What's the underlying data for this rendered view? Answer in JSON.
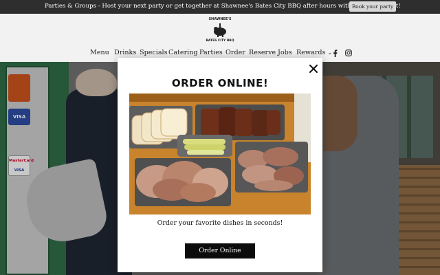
{
  "announcement": {
    "text": "Parties & Groups - Host your next party or get together at Shawnee's Bates City BBQ after hours with a private event!",
    "button_label": "Book your party"
  },
  "logo": {
    "top_text": "SHAWNEE'S",
    "bottom_text": "BATES CITY BBQ"
  },
  "nav": {
    "items": [
      "Menu",
      "Drinks",
      "Specials",
      "Catering",
      "Parties",
      "Order",
      "Reserve",
      "Jobs",
      "Rewards"
    ],
    "rewards_caret": "⌄",
    "social": [
      "facebook-icon",
      "instagram-icon"
    ]
  },
  "background": {
    "sticker_labels": [
      "VISA",
      "MasterCard",
      "VISA"
    ]
  },
  "modal": {
    "title": "ORDER ONLINE!",
    "close_label": "✕",
    "subtitle": "Order your favorite dishes in seconds!",
    "button_label": "Order Online"
  },
  "colors": {
    "announcement_bg": "#2e2e2e",
    "header_bg": "#f2f2f2",
    "button_bg": "#0c0c0c",
    "door_green": "#2f6b45",
    "tray_wood": "#c8832c"
  }
}
